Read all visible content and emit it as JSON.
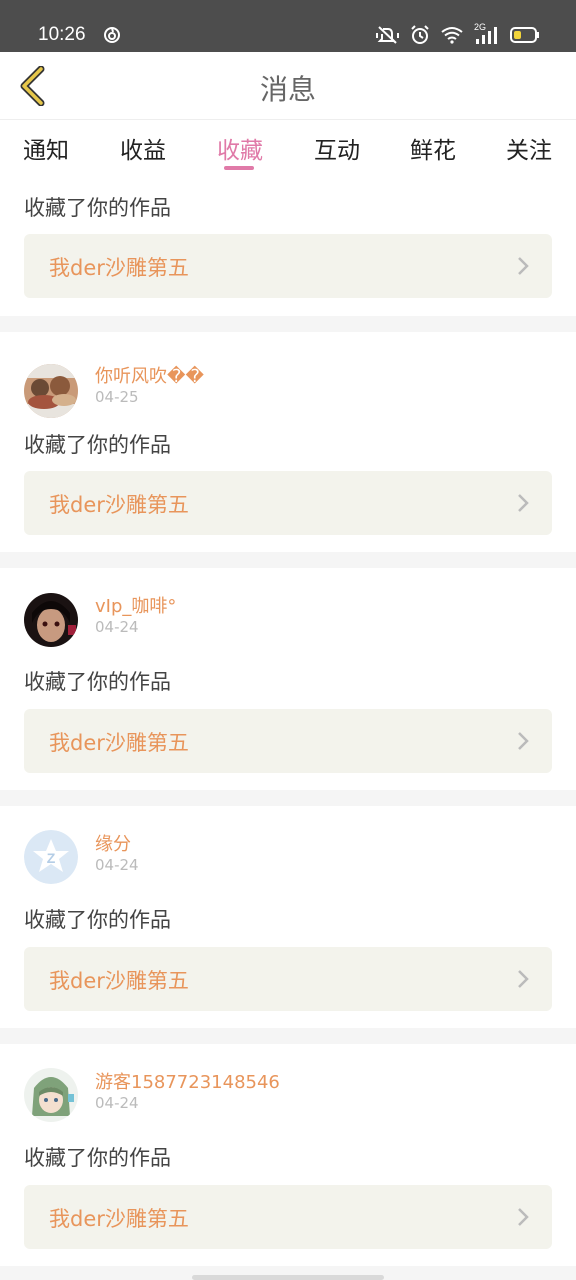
{
  "status_bar": {
    "time": "10:26",
    "network_label": "2G"
  },
  "header": {
    "title": "消息"
  },
  "tabs": [
    {
      "label": "通知"
    },
    {
      "label": "收益"
    },
    {
      "label": "收藏"
    },
    {
      "label": "互动"
    },
    {
      "label": "鲜花"
    },
    {
      "label": "关注"
    }
  ],
  "active_tab": "收藏",
  "colors": {
    "accent_pink": "#e07aa8",
    "accent_orange": "#e8955b",
    "box_bg": "#f3f3ec",
    "status_bar": "#4d4d4d"
  },
  "items": [
    {
      "username": "",
      "date": "",
      "message": "收藏了你的作品",
      "work_title": "我der沙雕第五"
    },
    {
      "username": "你听风吹��",
      "date": "04-25",
      "message": "收藏了你的作品",
      "work_title": "我der沙雕第五"
    },
    {
      "username": "vIp_咖啡°",
      "date": "04-24",
      "message": "收藏了你的作品",
      "work_title": "我der沙雕第五"
    },
    {
      "username": "缘分",
      "date": "04-24",
      "message": "收藏了你的作品",
      "work_title": "我der沙雕第五"
    },
    {
      "username": "游客1587723148546",
      "date": "04-24",
      "message": "收藏了你的作品",
      "work_title": "我der沙雕第五"
    }
  ]
}
